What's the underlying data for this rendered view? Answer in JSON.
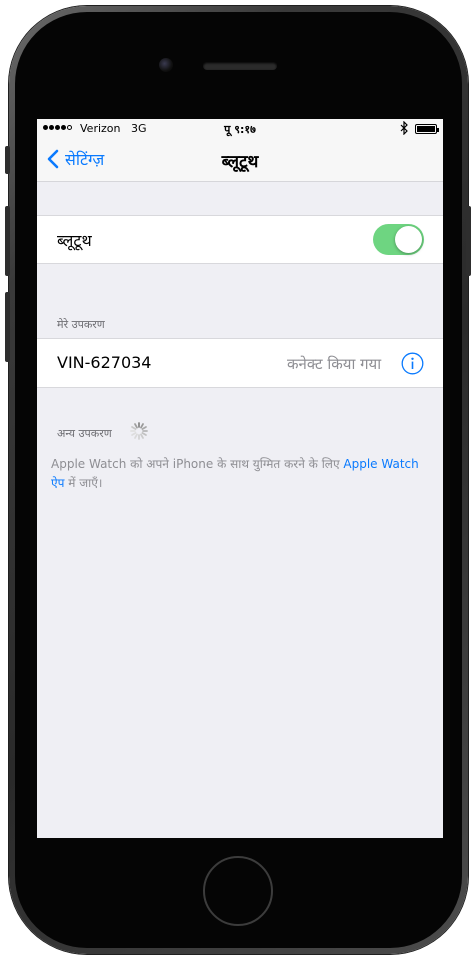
{
  "status_bar": {
    "carrier": "Verizon",
    "network": "3G",
    "time": "पू ९:१७",
    "icons": [
      "signal-dots-icon",
      "bluetooth-icon",
      "battery-icon"
    ]
  },
  "nav_bar": {
    "back_label": "सेटिंग्ज़",
    "title": "ब्लूटूथ"
  },
  "bluetooth_toggle": {
    "label": "ब्लूटूथ",
    "enabled": true
  },
  "my_devices": {
    "header": "मेरे उपकरण",
    "devices": [
      {
        "name": "VIN-627034",
        "status": "कनेक्ट किया गया",
        "icon": "info-icon"
      }
    ]
  },
  "other_devices": {
    "header": "अन्य उपकरण",
    "icon": "loading-spinner-icon"
  },
  "footer": {
    "text_before": "Apple Watch को अपने iPhone के साथ युग्मित करने के लिए ",
    "link_text": "Apple Watch ऐप",
    "text_after": " में जाएँ।"
  },
  "colors": {
    "accent": "#0a7afe",
    "toggle_on": "#6ed581",
    "background": "#efeff4",
    "secondary_text": "#8e8e93"
  }
}
